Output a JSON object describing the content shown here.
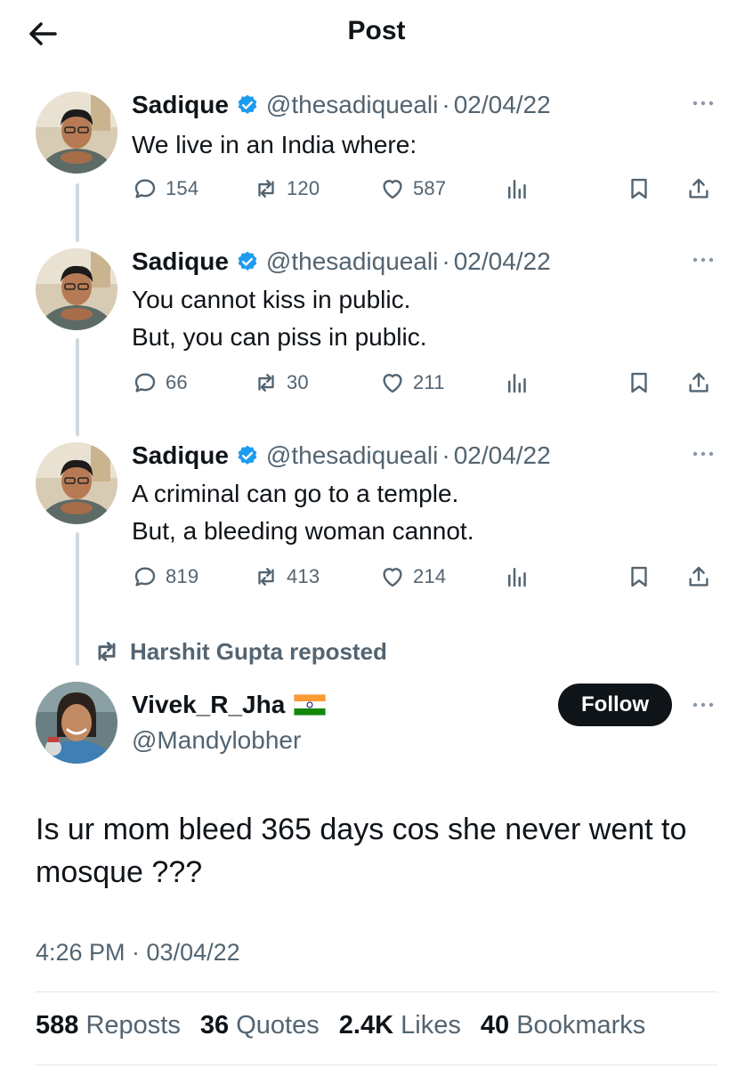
{
  "header": {
    "title": "Post",
    "back_icon": "arrow-left-icon"
  },
  "thread": [
    {
      "name": "Sadique",
      "handle": "@thesadiqueali",
      "separator": "·",
      "date": "02/04/22",
      "lines": [
        "We live in an India where:"
      ],
      "replies": "154",
      "reposts": "120",
      "likes": "587"
    },
    {
      "name": "Sadique",
      "handle": "@thesadiqueali",
      "separator": "·",
      "date": "02/04/22",
      "lines": [
        "You cannot kiss in public.",
        "But, you can piss in public."
      ],
      "replies": "66",
      "reposts": "30",
      "likes": "211"
    },
    {
      "name": "Sadique",
      "handle": "@thesadiqueali",
      "separator": "·",
      "date": "02/04/22",
      "lines": [
        "A criminal can go to a temple.",
        "But, a bleeding woman cannot."
      ],
      "replies": "819",
      "reposts": "413",
      "likes": "214"
    }
  ],
  "repost_banner": "Harshit Gupta reposted",
  "main_post": {
    "name": "Vivek_R_Jha",
    "handle": "@Mandylobher",
    "follow_label": "Follow",
    "text_line1": "Is ur mom bleed 365 days cos she never went to",
    "text_line2": "mosque ???",
    "timestamp": "4:26 PM · 03/04/22"
  },
  "stats": {
    "reposts_count": "588",
    "reposts_label": "Reposts",
    "quotes_count": "36",
    "quotes_label": "Quotes",
    "likes_count": "2.4K",
    "likes_label": "Likes",
    "bookmarks_count": "40",
    "bookmarks_label": "Bookmarks"
  },
  "colors": {
    "verified": "#1d9bf0",
    "muted": "#536471",
    "text": "#0f1419",
    "thread_line": "#cfd9de"
  }
}
